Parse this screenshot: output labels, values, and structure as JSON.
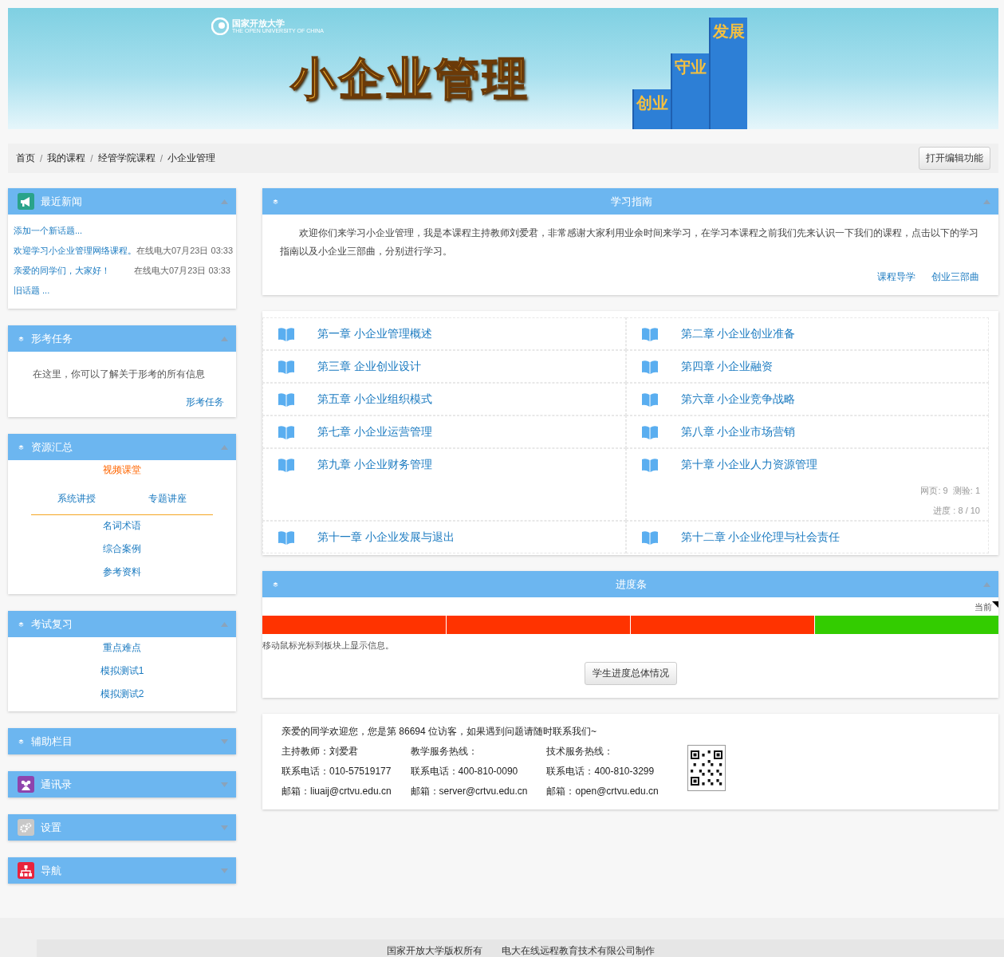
{
  "banner": {
    "logo_text": "国家开放大学",
    "logo_subtext": "THE OPEN UNIVERSITY OF CHINA",
    "title": "小企业管理",
    "stairs": [
      "创业",
      "守业",
      "发展"
    ]
  },
  "breadcrumb": [
    {
      "label": "首页"
    },
    {
      "separator": "/",
      "label": "我的课程"
    },
    {
      "separator": "/",
      "label": "经管学院课程"
    },
    {
      "separator": "/",
      "label": "小企业管理"
    }
  ],
  "edit_button": "打开编辑功能",
  "sidebar": [
    {
      "kind": "news",
      "title": "最近新闻",
      "expanded": true,
      "add_link": "添加一个新话题...",
      "items": [
        {
          "title": "欢迎学习小企业管理网络课程。",
          "meta": "在线电大07月23日 03:33"
        },
        {
          "title": "亲爱的同学们，大家好！",
          "meta": "在线电大07月23日 03:33"
        }
      ],
      "old_link": "旧话题 ..."
    },
    {
      "kind": "info",
      "title": "形考任务",
      "expanded": true,
      "text": "在这里，你可以了解关于形考的所有信息",
      "link": "形考任务"
    },
    {
      "kind": "resources",
      "title": "资源汇总",
      "expanded": true,
      "video": "视频课堂",
      "sub_links": [
        "系统讲授",
        "专题讲座"
      ],
      "links": [
        "名词术语",
        "综合案例",
        "参考资料"
      ]
    },
    {
      "kind": "links",
      "title": "考试复习",
      "expanded": true,
      "links": [
        "重点难点",
        "模拟测试1",
        "模拟测试2"
      ]
    },
    {
      "title": "辅助栏目",
      "expanded": false
    },
    {
      "title": "通讯录",
      "expanded": false
    },
    {
      "title": "设置",
      "expanded": false
    },
    {
      "title": "导航",
      "expanded": false
    }
  ],
  "guide": {
    "title": "学习指南",
    "expanded": true,
    "text": "欢迎你们来学习小企业管理，我是本课程主持教师刘爱君，非常感谢大家利用业余时间来学习，在学习本课程之前我们先来认识一下我们的课程，点击以下的学习指南以及小企业三部曲，分别进行学习。",
    "links": [
      "课程导学",
      "创业三部曲"
    ]
  },
  "chapters": [
    {
      "title": "第一章 小企业管理概述"
    },
    {
      "title": "第二章 小企业创业准备"
    },
    {
      "title": "第三章 企业创业设计"
    },
    {
      "title": "第四章 小企业融资"
    },
    {
      "title": "第五章 小企业组织模式"
    },
    {
      "title": "第六章 小企业竞争战略"
    },
    {
      "title": "第七章 小企业运营管理"
    },
    {
      "title": "第八章 小企业市场营销"
    },
    {
      "title": "第九章 小企业财务管理"
    },
    {
      "title": "第十章 小企业人力资源管理",
      "stats": [
        "网页: 9  测验: 1",
        "进度 : 8 / 10"
      ]
    },
    {
      "title": "第十一章   小企业发展与退出"
    },
    {
      "title": "第十二章 小企业伦理与社会责任"
    }
  ],
  "progress": {
    "title": "进度条",
    "expanded": true,
    "current_label": "当前",
    "segments": [
      {
        "color": "#ff3300"
      },
      {
        "color": "#ff3300"
      },
      {
        "color": "#ff3300"
      },
      {
        "color": "#33cc00"
      }
    ],
    "hint": "移动鼠标光标到板块上显示信息。",
    "button": "学生进度总体情况"
  },
  "contact": {
    "intro": "亲爱的同学欢迎您，您是第 86694 位访客，如果遇到问题请随时联系我们~",
    "columns": [
      [
        "主持教师：刘爱君",
        "联系电话：010-57519177",
        "邮箱：liuaij@crtvu.edu.cn"
      ],
      [
        "教学服务热线：",
        "联系电话：400-810-0090",
        "邮箱：server@crtvu.edu.cn"
      ],
      [
        "技术服务热线：",
        "联系电话：400-810-3299",
        "邮箱：open@crtvu.edu.cn"
      ]
    ]
  },
  "footer": [
    "国家开放大学版权所有",
    "电大在线远程教育技术有限公司制作"
  ]
}
